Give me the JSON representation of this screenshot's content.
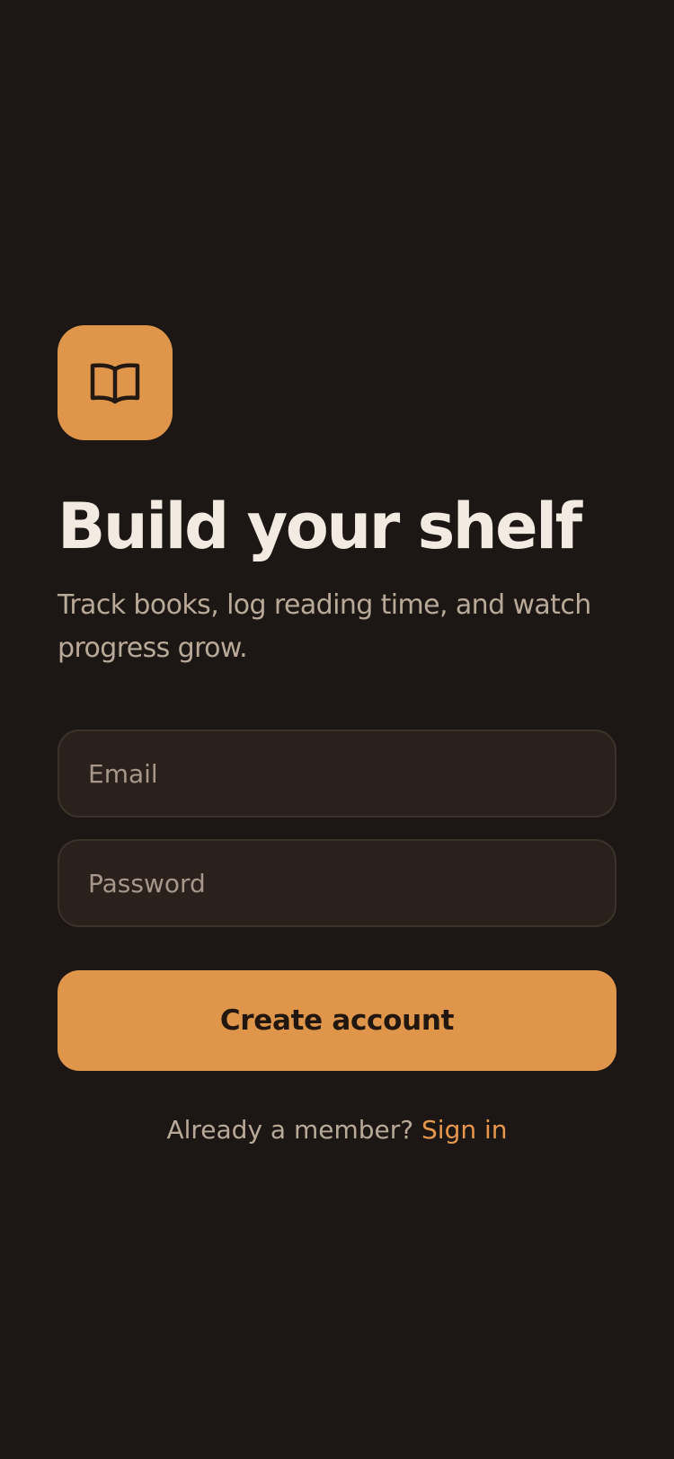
{
  "brand": {
    "icon": "open-book-icon",
    "accent_color": "#df964a",
    "background_color": "#1c1714"
  },
  "header": {
    "title": "Build your shelf",
    "subtitle": "Track books, log reading time, and watch progress grow."
  },
  "form": {
    "email": {
      "value": "",
      "placeholder": "Email"
    },
    "password": {
      "value": "",
      "placeholder": "Password"
    },
    "submit_label": "Create account"
  },
  "footer": {
    "prompt": "Already a member?",
    "link_label": "Sign in"
  }
}
